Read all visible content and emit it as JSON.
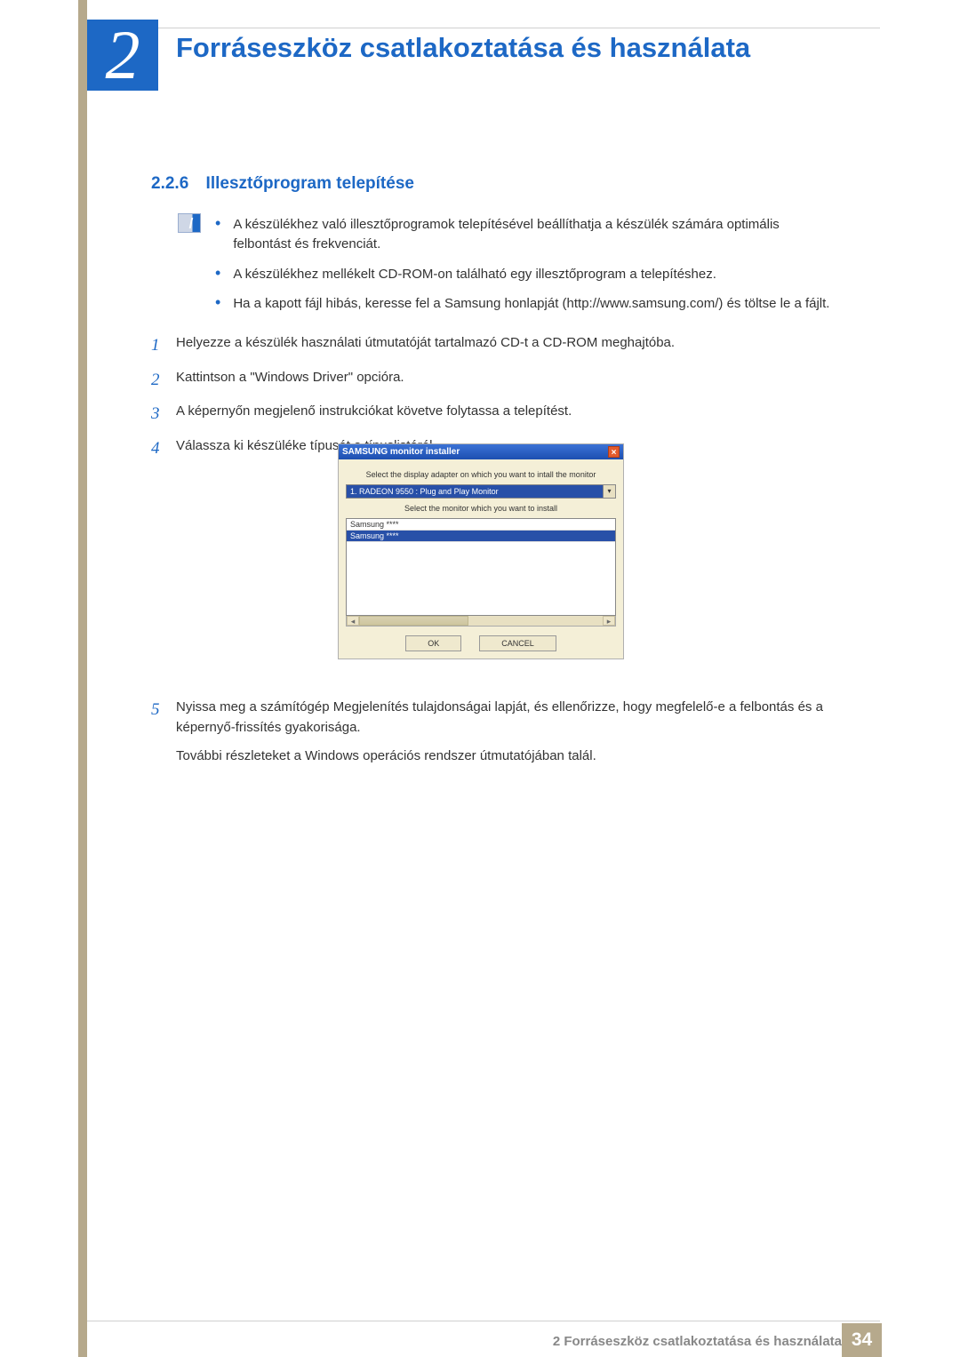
{
  "chapter": {
    "number": "2",
    "title": "Forráseszköz csatlakoztatása és használata"
  },
  "section": {
    "number": "2.2.6",
    "title": "Illesztőprogram telepítése"
  },
  "bullets": [
    "A készülékhez való illesztőprogramok telepítésével beállíthatja a készülék számára optimális felbontást és frekvenciát.",
    "A készülékhez mellékelt CD-ROM-on található egy illesztőprogram a telepítéshez.",
    "Ha a kapott fájl hibás, keresse fel a Samsung honlapját (http://www.samsung.com/) és töltse le a fájlt."
  ],
  "steps": {
    "s1": "Helyezze a készülék használati útmutatóját tartalmazó CD-t a CD-ROM meghajtóba.",
    "s2": "Kattintson a \"Windows Driver\" opcióra.",
    "s3": "A képernyőn megjelenő instrukciókat követve folytassa a telepítést.",
    "s4": "Válassza ki készüléke típusát a típuslistáról.",
    "s5": "Nyissa meg a számítógép Megjelenítés tulajdonságai lapját, és ellenőrizze, hogy megfelelő-e a felbontás és a képernyő-frissítés gyakorisága.",
    "s5_extra": "További részleteket a Windows operációs rendszer útmutatójában talál."
  },
  "installer": {
    "title": "SAMSUNG monitor installer",
    "close": "×",
    "label_adapter": "Select the display adapter on which you want to intall the monitor",
    "adapter_value": "1. RADEON 9550 : Plug and Play Monitor",
    "label_monitor": "Select the monitor which you want to install",
    "list_item1": "Samsung ****",
    "list_item2": "Samsung ****",
    "ok": "OK",
    "cancel": "CANCEL"
  },
  "footer": {
    "text": "2 Forráseszköz csatlakoztatása és használata",
    "page": "34"
  }
}
